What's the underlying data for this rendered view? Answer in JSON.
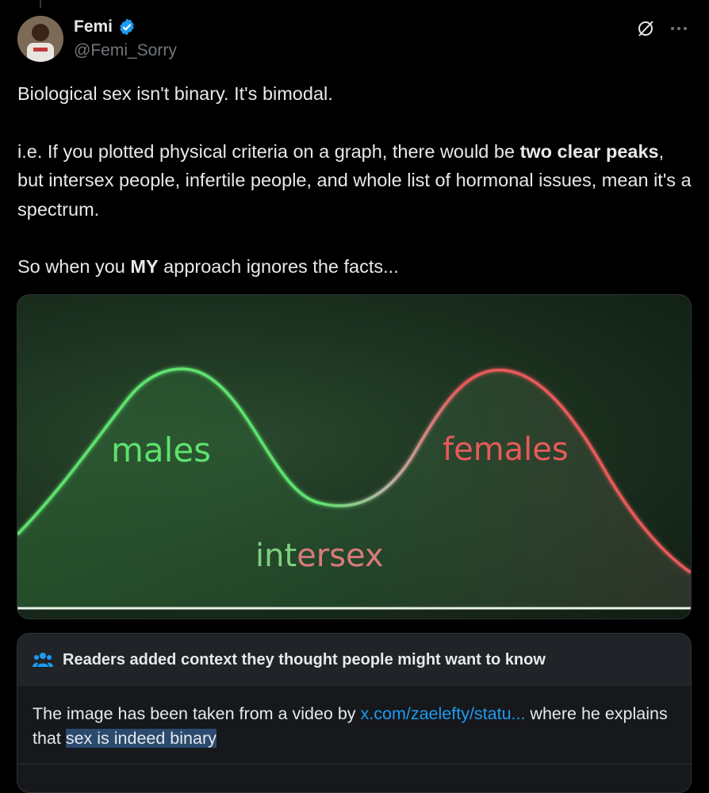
{
  "author": {
    "name": "Femi",
    "handle": "@Femi_Sorry"
  },
  "icons": {
    "verified": "verified-badge-icon",
    "grok": "grok-icon",
    "more": "more-icon",
    "readers": "readers-icon"
  },
  "colors": {
    "accent": "#1d9bf0",
    "male_curve": "#5fe26d",
    "female_curve": "#e85a5a",
    "intersex_green": "#7ed07f",
    "intersex_pink": "#d97a7a"
  },
  "tweet": {
    "line1": "Biological sex isn't binary. It's bimodal.",
    "p2_a": "i.e. If you plotted physical criteria on a graph, there would be ",
    "p2_bold": "two clear peaks",
    "p2_b": ", but intersex people, infertile people, and whole list of hormonal issues, mean it's a spectrum.",
    "p3_a": "So when you ",
    "p3_bold": "MY",
    "p3_b": " approach ignores the facts..."
  },
  "image": {
    "label_males": "males",
    "label_females": "females",
    "label_intersex_a": "int",
    "label_intersex_b": "ersex"
  },
  "note": {
    "header": "Readers added context they thought people might want to know",
    "body_a": "The image has been taken from a video by ",
    "link": "x.com/zaelefty/statu...",
    "body_b": " where he explains that ",
    "highlight": "sex is indeed binary"
  }
}
